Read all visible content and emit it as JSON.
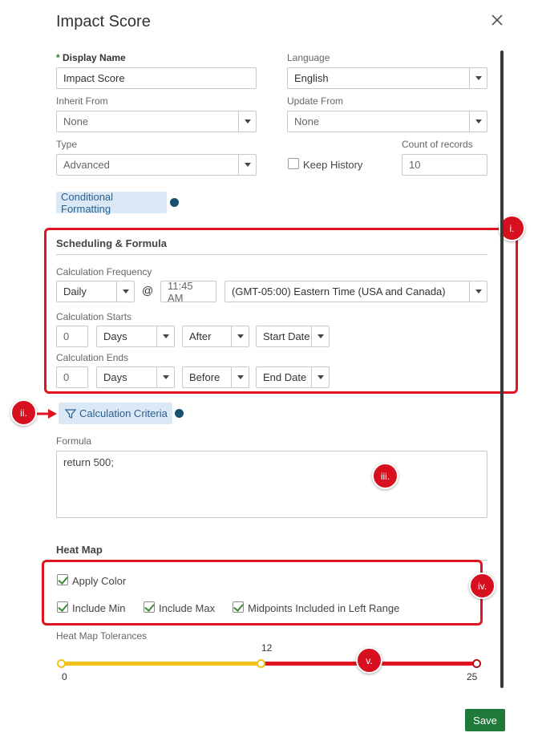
{
  "dialog": {
    "title": "Impact Score",
    "close_label": "×"
  },
  "display_name": {
    "required_mark": "*",
    "label": "Display Name",
    "value": "Impact Score"
  },
  "language": {
    "label": "Language",
    "value": "English"
  },
  "inherit_from": {
    "label": "Inherit From",
    "value": "None"
  },
  "update_from": {
    "label": "Update From",
    "value": "None"
  },
  "type": {
    "label": "Type",
    "value": "Advanced"
  },
  "keep_history": {
    "label": "Keep History",
    "checked": false
  },
  "count_of_records": {
    "label": "Count of records",
    "value": "10"
  },
  "conditional_formatting": {
    "label": "Conditional Formatting"
  },
  "scheduling": {
    "title": "Scheduling & Formula",
    "frequency_label": "Calculation Frequency",
    "frequency_value": "Daily",
    "at_symbol": "@",
    "time_value": "11:45 AM",
    "timezone_value": "(GMT-05:00) Eastern Time (USA and Canada)",
    "starts_label": "Calculation Starts",
    "starts_number": "0",
    "starts_unit": "Days",
    "starts_relation": "After",
    "starts_anchor": "Start Date",
    "ends_label": "Calculation Ends",
    "ends_number": "0",
    "ends_unit": "Days",
    "ends_relation": "Before",
    "ends_anchor": "End Date"
  },
  "calculation_criteria": {
    "label": "Calculation Criteria"
  },
  "formula": {
    "label": "Formula",
    "value": "return 500;"
  },
  "heat_map": {
    "title": "Heat Map",
    "apply_color": {
      "label": "Apply Color",
      "checked": true
    },
    "include_min": {
      "label": "Include Min",
      "checked": true
    },
    "include_max": {
      "label": "Include Max",
      "checked": true
    },
    "midpoints": {
      "label": "Midpoints Included in Left Range",
      "checked": true
    },
    "tolerances_label": "Heat Map Tolerances",
    "slider_min": "0",
    "slider_mid": "12",
    "slider_max": "25",
    "low_color": "#f2c21b",
    "high_color": "#e0151f"
  },
  "annotations": {
    "i": "i.",
    "ii": "ii.",
    "iii": "iii.",
    "iv": "iv.",
    "v": "v."
  },
  "footer": {
    "save_label": "Save"
  }
}
